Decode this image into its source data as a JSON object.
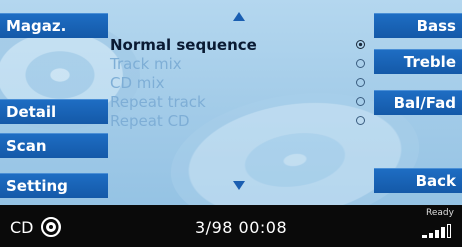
{
  "left_softkeys": [
    {
      "label": "Magaz."
    },
    {
      "label": "Detail"
    },
    {
      "label": "Scan"
    },
    {
      "label": "Setting"
    }
  ],
  "right_softkeys": [
    {
      "label": "Bass"
    },
    {
      "label": "Treble"
    },
    {
      "label": "Bal/Fad"
    },
    {
      "label": "Back"
    }
  ],
  "menu": {
    "items": [
      {
        "label": "Normal sequence",
        "selected": true
      },
      {
        "label": "Track mix",
        "selected": false
      },
      {
        "label": "CD mix",
        "selected": false
      },
      {
        "label": "Repeat track",
        "selected": false
      },
      {
        "label": "Repeat CD",
        "selected": false
      }
    ]
  },
  "status_bar": {
    "source": "CD",
    "track_time": "3/98 00:08",
    "ready_text": "Ready",
    "signal_icon": "signal-strength-icon",
    "cd_icon": "cd-disc-icon"
  },
  "colors": {
    "softkey_blue": "#1a63b8",
    "background": "#a2cbe8",
    "status_bar": "#0a0a0a",
    "dim_text": "#7eaed6"
  }
}
